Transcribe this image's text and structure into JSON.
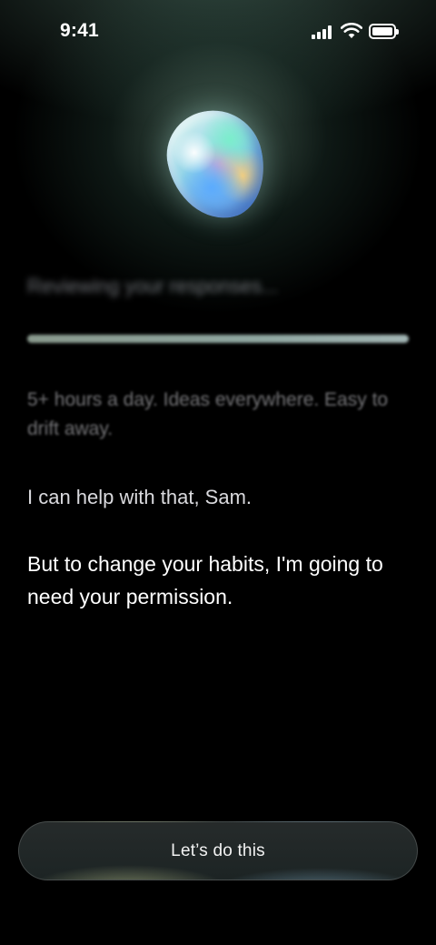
{
  "status_bar": {
    "time": "9:41",
    "signal_icon": "cellular-signal-icon",
    "wifi_icon": "wifi-icon",
    "battery_icon": "battery-icon"
  },
  "hero": {
    "image": "opal-gem"
  },
  "progress": {
    "label": "Reviewing your responses...",
    "value": 1.0
  },
  "summary": {
    "text": "5+ hours a day. Ideas everywhere. Easy to drift away."
  },
  "messages": {
    "help": "I can help with that, Sam.",
    "permission": "But to change your habits, I'm going to need your permission."
  },
  "cta": {
    "label": "Let’s do this"
  },
  "colors": {
    "background": "#000000",
    "glow": "#5a8275",
    "text": "#ffffff"
  }
}
